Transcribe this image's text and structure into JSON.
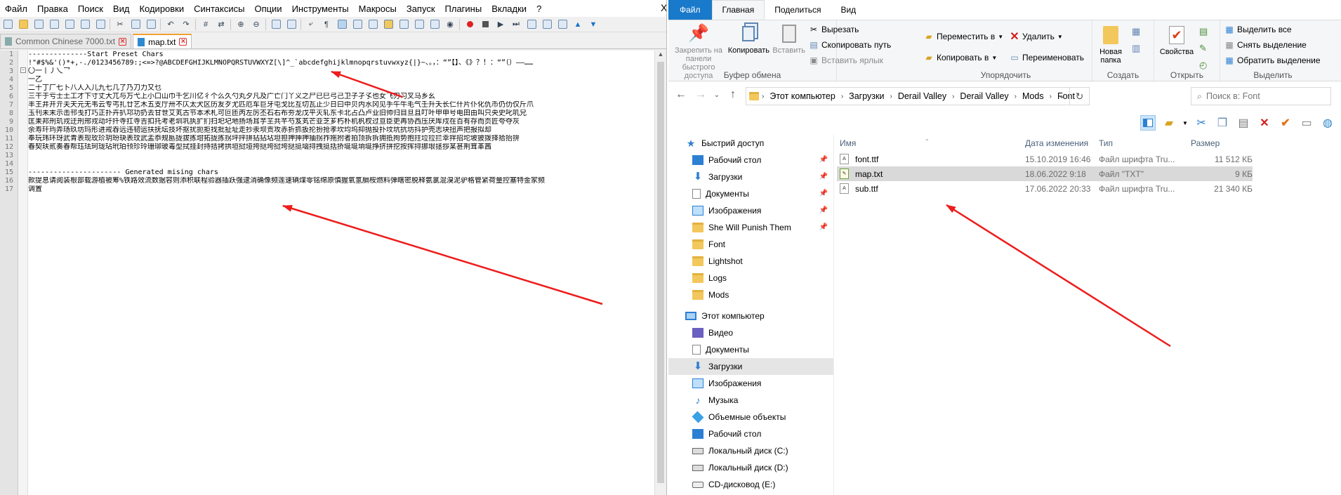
{
  "notepad": {
    "menu": [
      "Файл",
      "Правка",
      "Поиск",
      "Вид",
      "Кодировки",
      "Синтаксисы",
      "Опции",
      "Инструменты",
      "Макросы",
      "Запуск",
      "Плагины",
      "Вкладки",
      "?"
    ],
    "close_label": "X",
    "tabs": [
      {
        "label": "Common Chinese 7000.txt",
        "active": false
      },
      {
        "label": "map.txt",
        "active": true
      }
    ],
    "line_numbers": [
      "1",
      "2",
      "3",
      "4",
      "5",
      "6",
      "7",
      "8",
      "9",
      "10",
      "11",
      "12",
      "13",
      "14",
      "15",
      "16",
      "17"
    ],
    "lines": [
      "--------------Start Preset Chars",
      " !\"#$%&'()*+,-./0123456789:;<=>?@ABCDEFGHIJKLMNOPQRSTUVWXYZ[\\]^_`abcdefghijklmnopqrstuvwxyz{|}~、。，：“”【】、《》？！：“”（）——……",
      "〇一丨丿乀乛",
      "一乙",
      "二十丁厂七卜八人入儿九七几了乃刀力又乜",
      "三干于亏士土工才下寸丈大兀与万弋上小口山巾千乞川亿彳个么久勺丸夕凡及广亡门丫义之尸已巳弓己卫子孑孓也女飞刃习叉马乡幺",
      "丰王井开亓夫天元无韦云专丐扎廿艺木五支厅卅不仄太犬区历友歹尤匹厄车巨牙屯戈比互切瓦止少日曰中贝内水冈见手午牛毛气壬升夭长仁什片仆化仇币仍仂仅斤爪",
      "玉刊未末示击邗戋打巧正扑卉扒邛功扔去甘世艾芄古节本术札可叵匝丙左厉丕石右布夯龙戊平灭轧东卡北占凸卢业旧帅归目旦且叮叶甲申号电田由叫只央史叱叽兄",
      "匡耒邦刑玑戎迂刑邢戎动圩扦寺扛寺吉扣托考老圳巩执扩扪扫圯圮地扬场耳芋芏共芊芍芨芄芒亚芝芗朽朴机杋杈过亘臣吏再协西压厌厍戍在百有存而页匠夸夺灰",
      "余寿玕玙弄玚玖坊玛形进戒吞远违韧运扶抚坛技坏抠扰扼拒找批扯址走抄汞坝贡攻赤折抓扳抡扮抢孝坎均坞抑抛投扑坟坑抗坊抖护壳志块扭声把报拟却",
      "奉玩玮环玡武青表现玫玠玥玢玦表玟武盂忝规匦拢拔拣坩拓拢拣拐坪抨拼拈拈坫坦担押抻押抽拐拃拖拊者拍顶拆拆拥抵拘势抱拄垃拉拦幸拌招坨坡披拨择拾抬拚",
      "春契玞贰奏春帮珏珐珂珑玷玳珀顸珍玲珊珋玻毒型拭挂封持拮拷拱垣挝垭挎挞垮挝垮挞挺垴挦拽挺括挢埏埏垧埏挣挤拼挖按挥挦挪垠拯拶某甚荆茸革茜",
      "",
      "",
      "---------------------- Generated mising chars",
      "款提息请阅装根部载游植被筹%铁路效流数据容则添积联程验器插跃强逮消确像频莲速辆煤零铭绵原慎握氧氢膈桉燃料弹瞎密脱释氨氯混溴泥驴格管紧荷量控塞特金家频",
      "调置"
    ]
  },
  "explorer": {
    "ribbon_tabs": [
      {
        "label": "Файл",
        "type": "file"
      },
      {
        "label": "Главная",
        "type": "active"
      },
      {
        "label": "Поделиться",
        "type": "normal"
      },
      {
        "label": "Вид",
        "type": "normal"
      }
    ],
    "clipboard": {
      "pin": "Закрепить на панели быстрого доступа",
      "copy": "Копировать",
      "paste": "Вставить",
      "cut": "Вырезать",
      "copy_path": "Скопировать путь",
      "paste_shortcut": "Вставить ярлык",
      "group": "Буфер обмена"
    },
    "organize": {
      "move_to": "Переместить в",
      "copy_to": "Копировать в",
      "delete": "Удалить",
      "rename": "Переименовать",
      "group": "Упорядочить"
    },
    "create": {
      "new_folder": "Новая папка",
      "group": "Создать"
    },
    "open": {
      "properties": "Свойства",
      "group": "Открыть"
    },
    "select": {
      "select_all": "Выделить все",
      "select_none": "Снять выделение",
      "invert": "Обратить выделение",
      "group": "Выделить"
    },
    "breadcrumbs": [
      "Этот компьютер",
      "Загрузки",
      "Derail Valley",
      "Derail Valley",
      "Mods",
      "Font"
    ],
    "search_placeholder": "Поиск в: Font",
    "nav": [
      {
        "label": "Быстрий доступ",
        "kind": "star",
        "indent": 0,
        "pin": false,
        "selected": false
      },
      {
        "label": "Рабочий стол",
        "kind": "blue",
        "indent": 1,
        "pin": true,
        "selected": false
      },
      {
        "label": "Загрузки",
        "kind": "download",
        "indent": 1,
        "pin": true,
        "selected": false
      },
      {
        "label": "Документы",
        "kind": "doc",
        "indent": 1,
        "pin": true,
        "selected": false
      },
      {
        "label": "Изображения",
        "kind": "pic",
        "indent": 1,
        "pin": true,
        "selected": false
      },
      {
        "label": "She Will Punish Them",
        "kind": "folder",
        "indent": 1,
        "pin": true,
        "selected": false
      },
      {
        "label": "Font",
        "kind": "folder",
        "indent": 1,
        "pin": false,
        "selected": false
      },
      {
        "label": "Lightshot",
        "kind": "folder",
        "indent": 1,
        "pin": false,
        "selected": false
      },
      {
        "label": "Logs",
        "kind": "folder",
        "indent": 1,
        "pin": false,
        "selected": false
      },
      {
        "label": "Mods",
        "kind": "folder",
        "indent": 1,
        "pin": false,
        "selected": false
      },
      {
        "label": "",
        "kind": "spacer",
        "indent": 0,
        "pin": false,
        "selected": false
      },
      {
        "label": "Этот компьютер",
        "kind": "pc",
        "indent": 0,
        "pin": false,
        "selected": false
      },
      {
        "label": "Видео",
        "kind": "video",
        "indent": 1,
        "pin": false,
        "selected": false
      },
      {
        "label": "Документы",
        "kind": "doc",
        "indent": 1,
        "pin": false,
        "selected": false
      },
      {
        "label": "Загрузки",
        "kind": "download",
        "indent": 1,
        "pin": false,
        "selected": true
      },
      {
        "label": "Изображения",
        "kind": "pic",
        "indent": 1,
        "pin": false,
        "selected": false
      },
      {
        "label": "Музыка",
        "kind": "music",
        "indent": 1,
        "pin": false,
        "selected": false
      },
      {
        "label": "Объемные объекты",
        "kind": "3d",
        "indent": 1,
        "pin": false,
        "selected": false
      },
      {
        "label": "Рабочий стол",
        "kind": "blue",
        "indent": 1,
        "pin": false,
        "selected": false
      },
      {
        "label": "Локальный диск (C:)",
        "kind": "disk",
        "indent": 1,
        "pin": false,
        "selected": false
      },
      {
        "label": "Локальный диск (D:)",
        "kind": "disk",
        "indent": 1,
        "pin": false,
        "selected": false
      },
      {
        "label": "CD-дисковод (E:)",
        "kind": "cd",
        "indent": 1,
        "pin": false,
        "selected": false
      }
    ],
    "columns": {
      "name": "Имя",
      "date": "Дата изменения",
      "type": "Тип",
      "size": "Размер"
    },
    "files": [
      {
        "name": "font.ttf",
        "date": "15.10.2019 16:46",
        "type": "Файл шрифта Tru...",
        "size": "11 512 КБ",
        "icon": "A",
        "selected": false
      },
      {
        "name": "map.txt",
        "date": "18.06.2022 9:18",
        "type": "Файл \"TXT\"",
        "size": "9 КБ",
        "icon": "txt",
        "selected": true
      },
      {
        "name": "sub.ttf",
        "date": "17.06.2022 20:33",
        "type": "Файл шрифта Tru...",
        "size": "21 340 КБ",
        "icon": "A",
        "selected": false
      }
    ]
  },
  "annotation": {
    "arrow_color": "#ee1c1c"
  }
}
